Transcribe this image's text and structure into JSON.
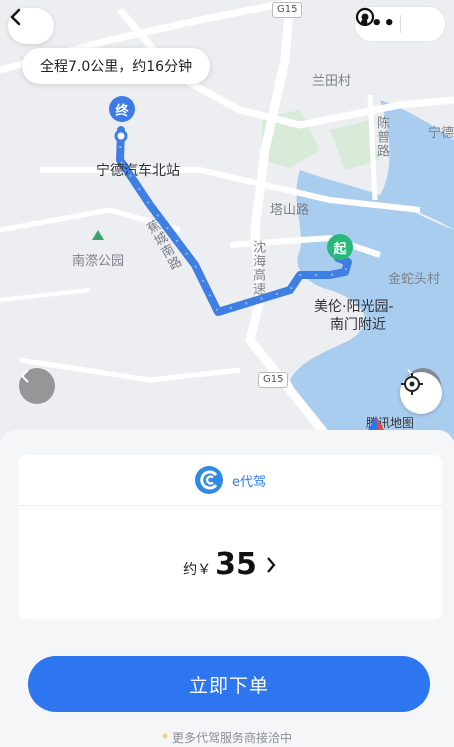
{
  "map": {
    "route_summary": "全程7.0公里，约16分钟",
    "end_marker": "终",
    "start_marker": "起",
    "labels": {
      "lantian": "兰田村",
      "chenpu": "陈普路",
      "ningde_right": "宁德",
      "station": "宁德汽车北站",
      "tashan": "塔山路",
      "nanji": "南漈公园",
      "jiaocheng": "蕉城南路",
      "shenhai": "沈海高速",
      "jinshe": "金蛇头村",
      "dest1": "美伦·阳光园-",
      "dest2": "南门附近",
      "g15_top": "G15",
      "g15_bottom": "G15",
      "tencent": "腾讯地图"
    }
  },
  "service": {
    "name": "e代驾",
    "price_prefix": "约￥",
    "price": "35"
  },
  "order_button": "立即下单",
  "footer_note": "更多代驾服务商接洽中",
  "colors": {
    "accent": "#2d76f0",
    "route": "#4a86e8",
    "start": "#26b97a"
  }
}
